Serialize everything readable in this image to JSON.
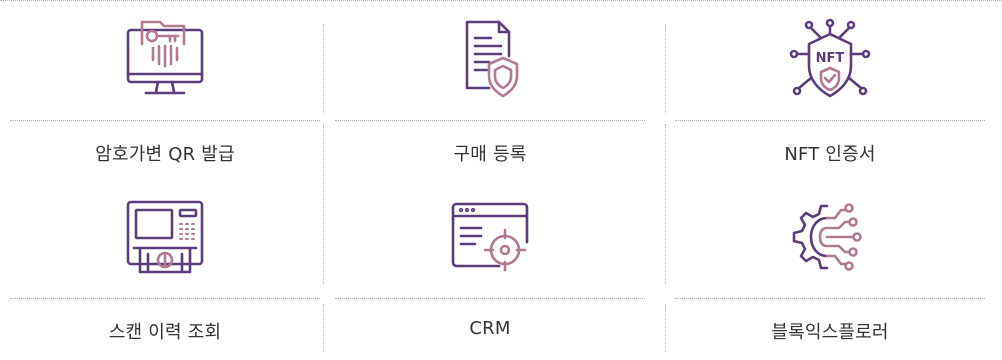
{
  "features": [
    {
      "label": "암호가변 QR 발급",
      "icon": "encrypted-qr-monitor-icon"
    },
    {
      "label": "구매 등록",
      "icon": "document-shield-icon"
    },
    {
      "label": "NFT 인증서",
      "icon": "nft-certificate-icon"
    },
    {
      "label": "스캔 이력 조회",
      "icon": "atm-scan-icon"
    },
    {
      "label": "CRM",
      "icon": "browser-target-icon"
    },
    {
      "label": "블록익스플로러",
      "icon": "gear-network-icon"
    }
  ],
  "colors": {
    "primary": "#5a3d7a",
    "accent": "#b07a92",
    "divider": "#b0b0b0"
  }
}
